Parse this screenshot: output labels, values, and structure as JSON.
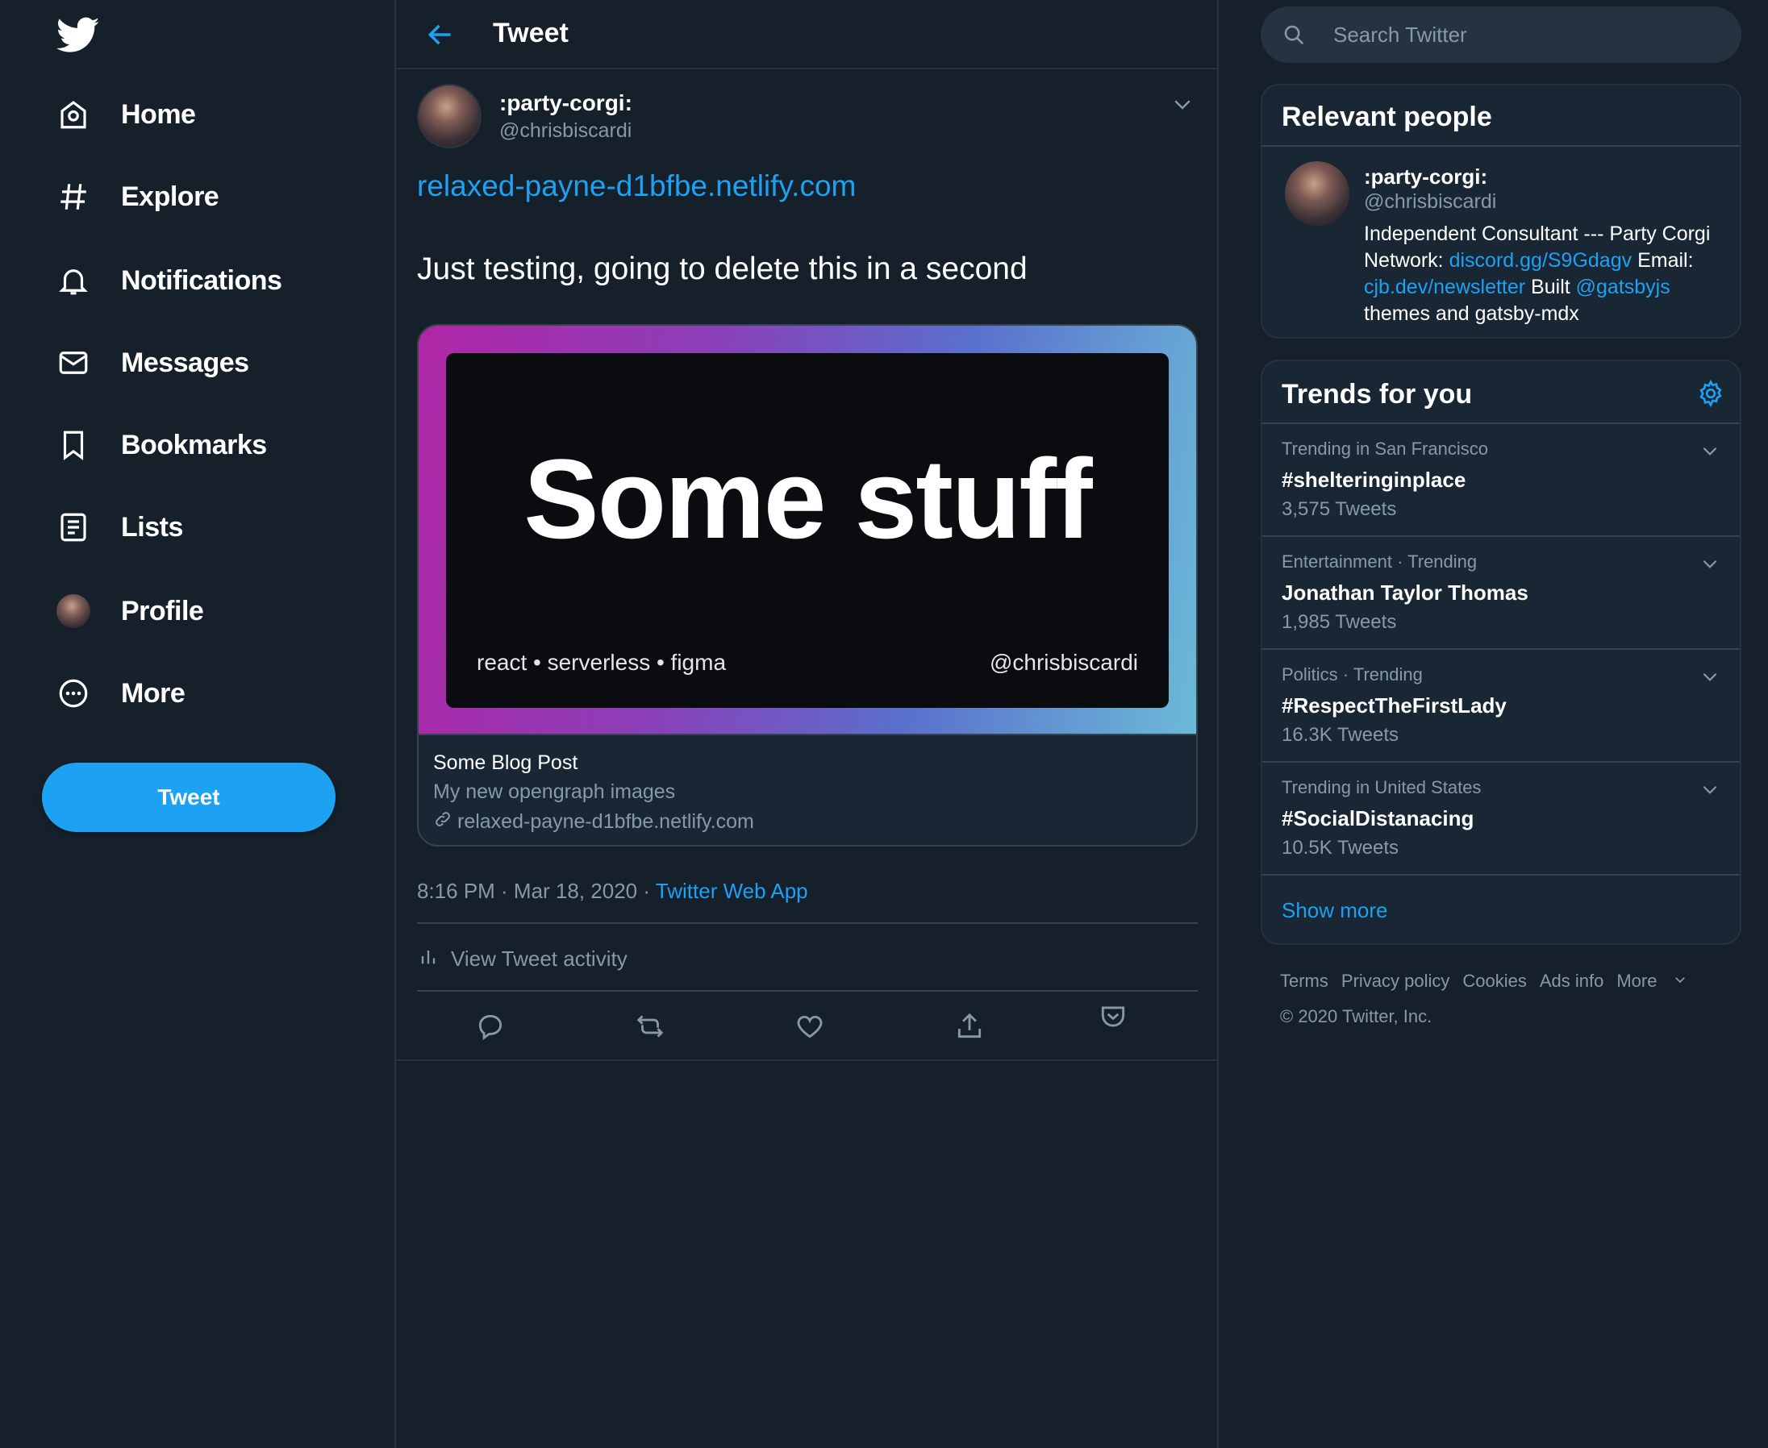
{
  "colors": {
    "background": "#15202b",
    "panel": "#192734",
    "accent": "#1da1f2",
    "muted_text": "#8899a6",
    "border": "#38444d"
  },
  "sidebar": {
    "logo_icon": "twitter-bird-icon",
    "items": [
      {
        "label": "Home",
        "icon": "home-icon"
      },
      {
        "label": "Explore",
        "icon": "hashtag-icon"
      },
      {
        "label": "Notifications",
        "icon": "bell-icon"
      },
      {
        "label": "Messages",
        "icon": "envelope-icon"
      },
      {
        "label": "Bookmarks",
        "icon": "bookmark-icon"
      },
      {
        "label": "Lists",
        "icon": "list-icon"
      },
      {
        "label": "Profile",
        "icon": "avatar"
      },
      {
        "label": "More",
        "icon": "more-circle-icon"
      }
    ],
    "tweet_button": "Tweet"
  },
  "header": {
    "title": "Tweet",
    "back_icon": "back-arrow-icon"
  },
  "tweet": {
    "author_name": ":party-corgi:",
    "author_handle": "@chrisbiscardi",
    "link_text": "relaxed-payne-d1bfbe.netlify.com",
    "text": "Just testing, going to delete this in a second",
    "card": {
      "image_title": "Some stuff",
      "image_tags": "react • serverless • figma",
      "image_handle": "@chrisbiscardi",
      "title": "Some Blog Post",
      "description": "My new opengraph images",
      "url": "relaxed-payne-d1bfbe.netlify.com"
    },
    "timestamp": "8:16 PM · Mar 18, 2020 · ",
    "source_app": "Twitter Web App",
    "activity_label": "View Tweet activity",
    "actions": [
      "reply-icon",
      "retweet-icon",
      "like-icon",
      "share-icon",
      "pocket-icon"
    ]
  },
  "search": {
    "placeholder": "Search Twitter"
  },
  "relevant_people": {
    "title": "Relevant people",
    "name": ":party-corgi:",
    "handle": "@chrisbiscardi",
    "bio_1": "Independent Consultant --- Party Corgi Network: ",
    "bio_link_1": "discord.gg/S9Gdagv",
    "bio_2": " Email: ",
    "bio_link_2": "cjb.dev/newsletter",
    "bio_3": " Built ",
    "bio_link_3": "@gatsbyjs",
    "bio_4": " themes and gatsby-mdx"
  },
  "trends": {
    "title": "Trends for you",
    "items": [
      {
        "context": "Trending in San Francisco",
        "name": "#shelteringinplace",
        "count": "3,575 Tweets"
      },
      {
        "context": "Entertainment · Trending",
        "name": "Jonathan Taylor Thomas",
        "count": "1,985 Tweets"
      },
      {
        "context": "Politics · Trending",
        "name": "#RespectTheFirstLady",
        "count": "16.3K Tweets"
      },
      {
        "context": "Trending in United States",
        "name": "#SocialDistanacing",
        "count": "10.5K Tweets"
      }
    ],
    "show_more": "Show more"
  },
  "footer": {
    "links": [
      "Terms",
      "Privacy policy",
      "Cookies",
      "Ads info"
    ],
    "more": "More",
    "copyright": "© 2020 Twitter, Inc."
  }
}
